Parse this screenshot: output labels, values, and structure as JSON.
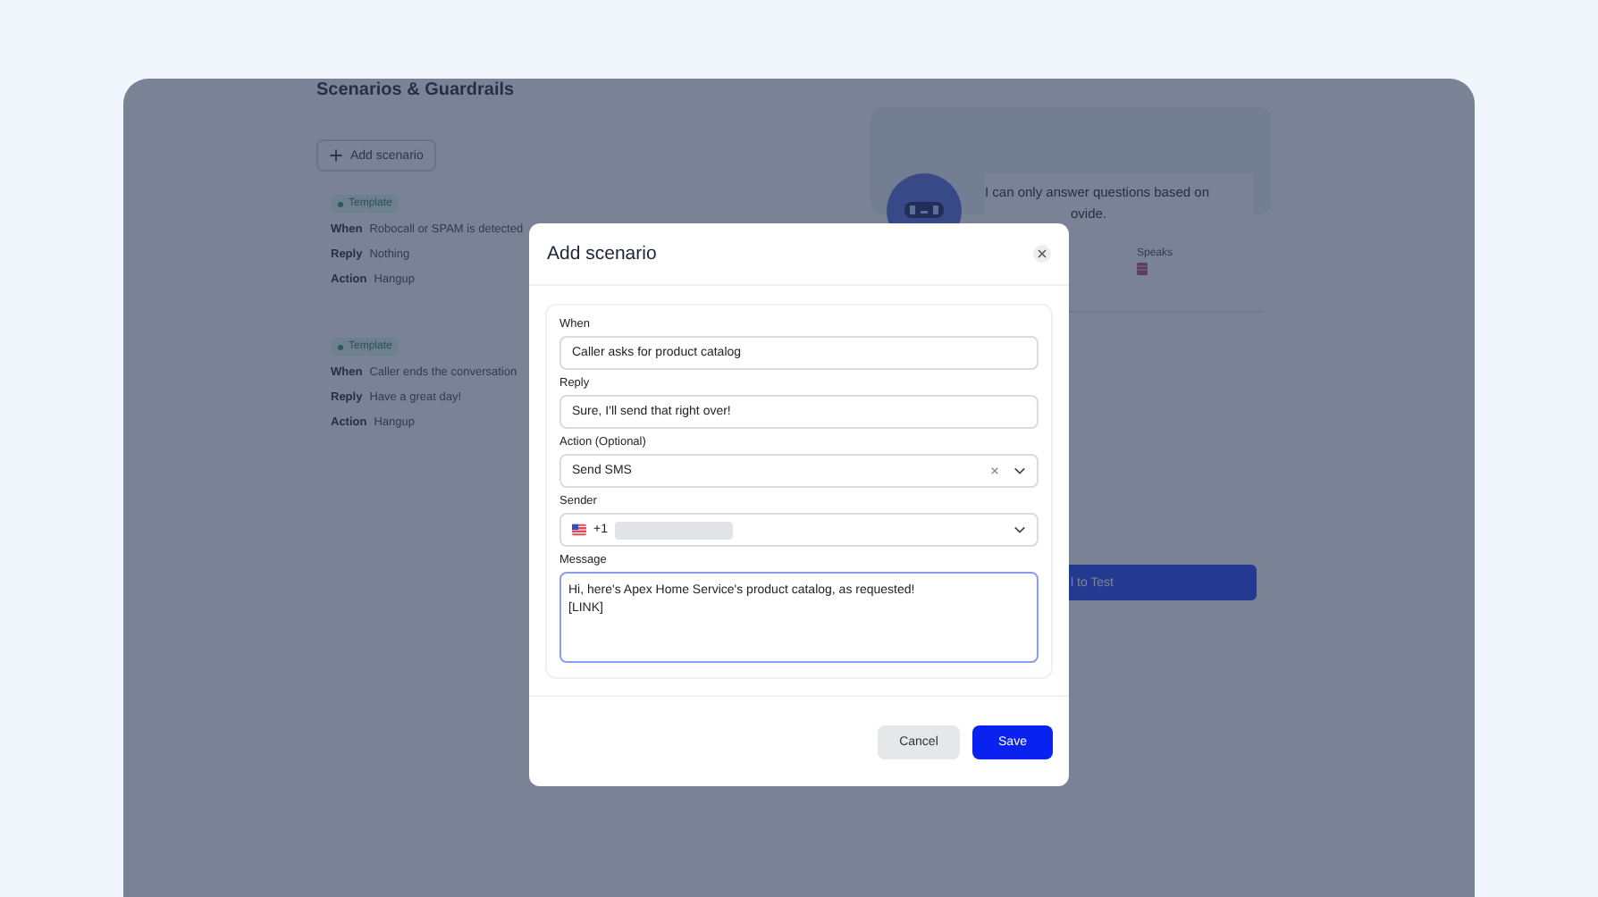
{
  "page_title": "Scenarios & Guardrails",
  "add_button": "Add scenario",
  "scenarios": [
    {
      "tag": "Template",
      "rows": [
        {
          "label": "When",
          "value": "Robocall or SPAM is detected"
        },
        {
          "label": "Reply",
          "value": "Nothing"
        },
        {
          "label": "Action",
          "value": "Hangup"
        }
      ]
    },
    {
      "tag": "Template",
      "rows": [
        {
          "label": "When",
          "value": "Caller ends the conversation"
        },
        {
          "label": "Reply",
          "value": "Have a great day!"
        },
        {
          "label": "Action",
          "value": "Hangup"
        }
      ]
    }
  ],
  "preview": {
    "message_lines": [
      "I can only answer questions based on",
      "ovide."
    ],
    "speaks_label": "Speaks",
    "test_button": "l to Test"
  },
  "modal": {
    "title": "Add scenario",
    "fields": [
      {
        "kind": "text",
        "label": "When",
        "value": "Caller asks for product catalog"
      },
      {
        "kind": "text",
        "label": "Reply",
        "value": "Sure, I'll send that right over!"
      },
      {
        "kind": "select",
        "label": "Action (Optional)",
        "value": "Send SMS",
        "clearable": true
      },
      {
        "kind": "phone",
        "label": "Sender",
        "value": "+1"
      },
      {
        "kind": "textarea",
        "label": "Message",
        "value": "Hi, here's Apex Home Service's product catalog, as requested!\n[LINK]",
        "focused": true
      }
    ],
    "buttons": [
      {
        "label": "Cancel",
        "kind": "secondary"
      },
      {
        "label": "Save",
        "kind": "primary"
      }
    ]
  }
}
